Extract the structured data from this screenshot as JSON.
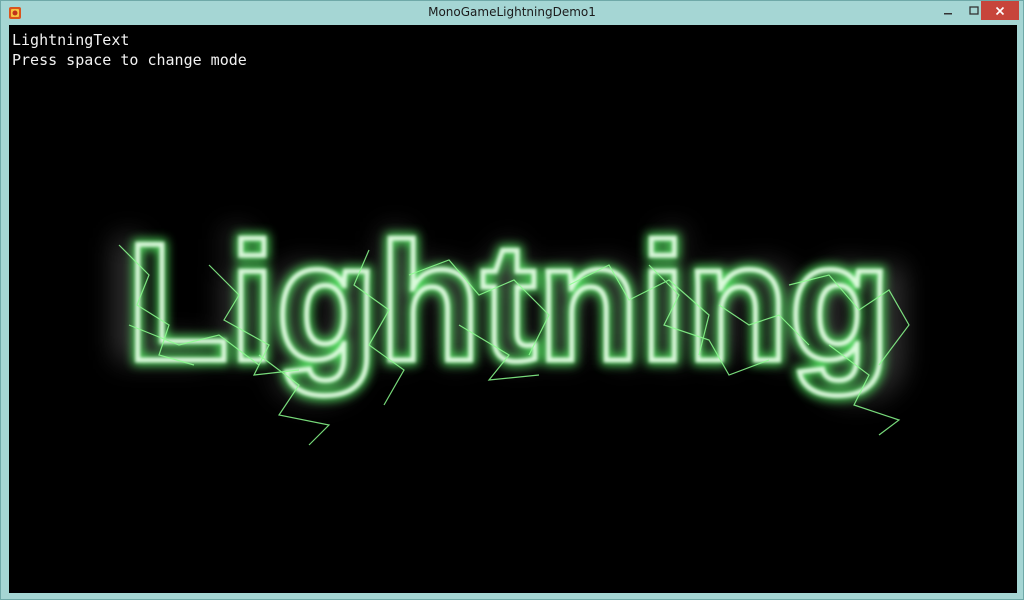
{
  "window": {
    "title": "MonoGameLightningDemo1"
  },
  "overlay": {
    "mode_label": "LightningText",
    "instruction": "Press space to change mode"
  },
  "canvas": {
    "rendered_text": "Lightning",
    "glow_color": "#5cff6a",
    "core_color": "#ffffff",
    "background_color": "#000000"
  },
  "icons": {
    "app": "game-app-icon",
    "minimize": "minimize-icon",
    "maximize": "maximize-icon",
    "close": "close-icon"
  }
}
